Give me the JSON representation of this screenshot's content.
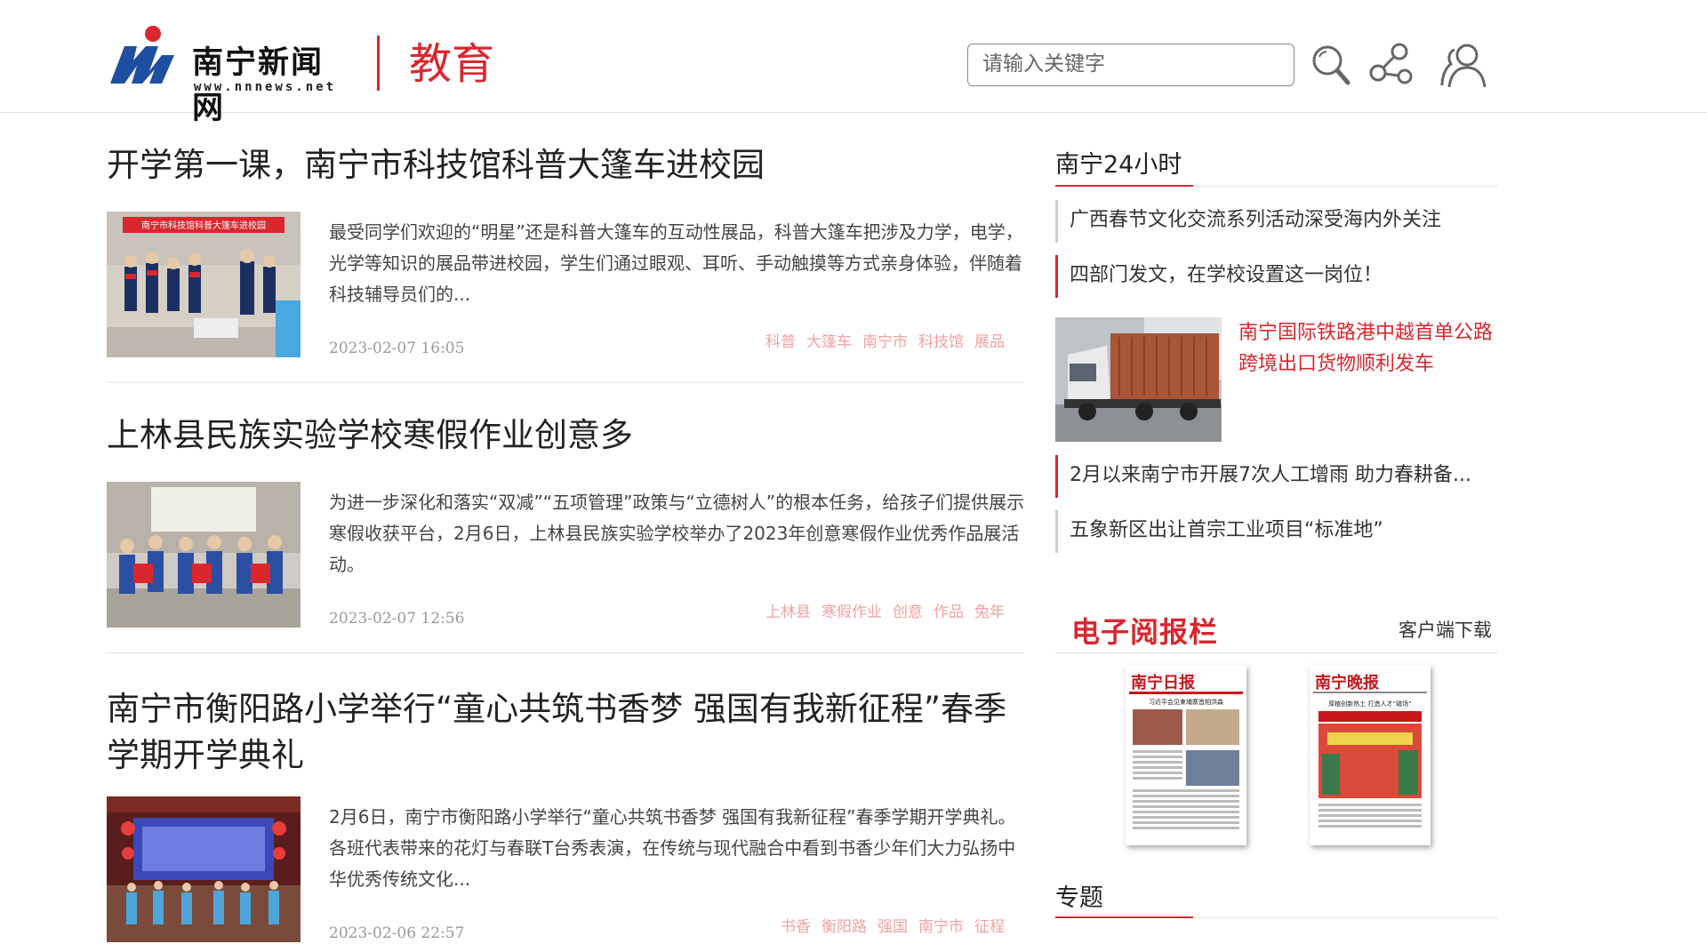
{
  "header": {
    "logo_name": "南宁新闻网",
    "logo_url": "www.nnnews.net",
    "section": "教育",
    "search_placeholder": "请输入关键字"
  },
  "icons": [
    "search-icon",
    "share-icon",
    "user-icon"
  ],
  "colors": {
    "brand_red": "#d9272e",
    "logo_blue": "#1e4fa0",
    "tag_pink": "#f2a1a1"
  },
  "articles": [
    {
      "title": "开学第一课，南宁市科技馆科普大篷车进校园",
      "summary": "最受同学们欢迎的“明星”还是科普大篷车的互动性展品，科普大篷车把涉及力学，电学，光学等知识的展品带进校园，学生们通过眼观、耳听、手动触摸等方式亲身体验，伴随着科技辅导员们的...",
      "date": "2023-02-07 16:05",
      "thumb_banner": "南宁市科技馆科普大篷车进校园",
      "tags": [
        "科普",
        "大篷车",
        "南宁市",
        "科技馆",
        "展品"
      ]
    },
    {
      "title": "上林县民族实验学校寒假作业创意多",
      "summary": "为进一步深化和落实“双减”“五项管理”政策与“立德树人”的根本任务，给孩子们提供展示寒假收获平台，2月6日，上林县民族实验学校举办了2023年创意寒假作业优秀作品展活动。",
      "date": "2023-02-07 12:56",
      "tags": [
        "上林县",
        "寒假作业",
        "创意",
        "作品",
        "兔年"
      ]
    },
    {
      "title": "南宁市衡阳路小学举行“童心共筑书香梦 强国有我新征程”春季学期开学典礼",
      "summary": "2月6日，南宁市衡阳路小学举行“童心共筑书香梦 强国有我新征程”春季学期开学典礼。各班代表带来的花灯与春联T台秀表演，在传统与现代融合中看到书香少年们大力弘扬中华优秀传统文化...",
      "date": "2023-02-06 22:57",
      "tags": [
        "书香",
        "衡阳路",
        "强国",
        "南宁市",
        "征程"
      ]
    }
  ],
  "sidebar": {
    "heading": "南宁24小时",
    "items": [
      "广西春节文化交流系列活动深受海内外关注",
      "四部门发文，在学校设置这一岗位！",
      "2月以来南宁市开展7次人工增雨 助力春耕备...",
      "五象新区出让首宗工业项目“标准地”"
    ],
    "feature_title": "南宁国际铁路港中越首单公路跨境出口货物顺利发车",
    "epaper_title": "电子阅报栏",
    "client_download": "客户端下载",
    "papers": [
      "南宁日报",
      "南宁晚报"
    ],
    "paper_headlines": [
      "习近平会见柬埔寨首相洪森",
      "厚植创新热土 打造人才“磁场”"
    ],
    "topics_heading": "专题"
  }
}
